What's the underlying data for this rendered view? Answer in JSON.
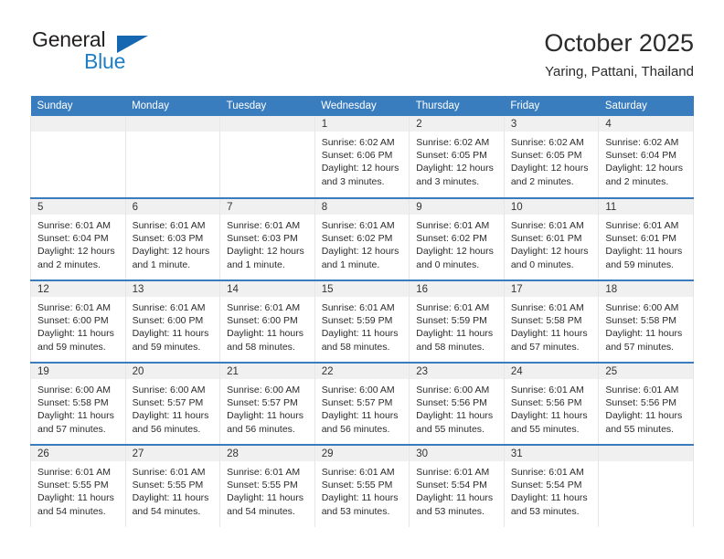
{
  "logo": {
    "primary_text": "General",
    "secondary_text": "Blue",
    "triangle_icon": "triangle-icon",
    "primary_color": "#221f1f",
    "secondary_color": "#1f7ec4",
    "triangle_color": "#1567b2"
  },
  "header": {
    "title": "October 2025",
    "subtitle": "Yaring, Pattani, Thailand"
  },
  "theme": {
    "header_bar_color": "#3a7dbf",
    "daynum_band_color": "#f0f0f0",
    "cell_border_color": "#e6e6e6",
    "text_color": "#2b2b2b"
  },
  "weekday_headers": [
    "Sunday",
    "Monday",
    "Tuesday",
    "Wednesday",
    "Thursday",
    "Friday",
    "Saturday"
  ],
  "weeks": [
    [
      {
        "day": "",
        "empty": true
      },
      {
        "day": "",
        "empty": true
      },
      {
        "day": "",
        "empty": true
      },
      {
        "day": "1",
        "sunrise": "Sunrise: 6:02 AM",
        "sunset": "Sunset: 6:06 PM",
        "daylight": "Daylight: 12 hours and 3 minutes."
      },
      {
        "day": "2",
        "sunrise": "Sunrise: 6:02 AM",
        "sunset": "Sunset: 6:05 PM",
        "daylight": "Daylight: 12 hours and 3 minutes."
      },
      {
        "day": "3",
        "sunrise": "Sunrise: 6:02 AM",
        "sunset": "Sunset: 6:05 PM",
        "daylight": "Daylight: 12 hours and 2 minutes."
      },
      {
        "day": "4",
        "sunrise": "Sunrise: 6:02 AM",
        "sunset": "Sunset: 6:04 PM",
        "daylight": "Daylight: 12 hours and 2 minutes."
      }
    ],
    [
      {
        "day": "5",
        "sunrise": "Sunrise: 6:01 AM",
        "sunset": "Sunset: 6:04 PM",
        "daylight": "Daylight: 12 hours and 2 minutes."
      },
      {
        "day": "6",
        "sunrise": "Sunrise: 6:01 AM",
        "sunset": "Sunset: 6:03 PM",
        "daylight": "Daylight: 12 hours and 1 minute."
      },
      {
        "day": "7",
        "sunrise": "Sunrise: 6:01 AM",
        "sunset": "Sunset: 6:03 PM",
        "daylight": "Daylight: 12 hours and 1 minute."
      },
      {
        "day": "8",
        "sunrise": "Sunrise: 6:01 AM",
        "sunset": "Sunset: 6:02 PM",
        "daylight": "Daylight: 12 hours and 1 minute."
      },
      {
        "day": "9",
        "sunrise": "Sunrise: 6:01 AM",
        "sunset": "Sunset: 6:02 PM",
        "daylight": "Daylight: 12 hours and 0 minutes."
      },
      {
        "day": "10",
        "sunrise": "Sunrise: 6:01 AM",
        "sunset": "Sunset: 6:01 PM",
        "daylight": "Daylight: 12 hours and 0 minutes."
      },
      {
        "day": "11",
        "sunrise": "Sunrise: 6:01 AM",
        "sunset": "Sunset: 6:01 PM",
        "daylight": "Daylight: 11 hours and 59 minutes."
      }
    ],
    [
      {
        "day": "12",
        "sunrise": "Sunrise: 6:01 AM",
        "sunset": "Sunset: 6:00 PM",
        "daylight": "Daylight: 11 hours and 59 minutes."
      },
      {
        "day": "13",
        "sunrise": "Sunrise: 6:01 AM",
        "sunset": "Sunset: 6:00 PM",
        "daylight": "Daylight: 11 hours and 59 minutes."
      },
      {
        "day": "14",
        "sunrise": "Sunrise: 6:01 AM",
        "sunset": "Sunset: 6:00 PM",
        "daylight": "Daylight: 11 hours and 58 minutes."
      },
      {
        "day": "15",
        "sunrise": "Sunrise: 6:01 AM",
        "sunset": "Sunset: 5:59 PM",
        "daylight": "Daylight: 11 hours and 58 minutes."
      },
      {
        "day": "16",
        "sunrise": "Sunrise: 6:01 AM",
        "sunset": "Sunset: 5:59 PM",
        "daylight": "Daylight: 11 hours and 58 minutes."
      },
      {
        "day": "17",
        "sunrise": "Sunrise: 6:01 AM",
        "sunset": "Sunset: 5:58 PM",
        "daylight": "Daylight: 11 hours and 57 minutes."
      },
      {
        "day": "18",
        "sunrise": "Sunrise: 6:00 AM",
        "sunset": "Sunset: 5:58 PM",
        "daylight": "Daylight: 11 hours and 57 minutes."
      }
    ],
    [
      {
        "day": "19",
        "sunrise": "Sunrise: 6:00 AM",
        "sunset": "Sunset: 5:58 PM",
        "daylight": "Daylight: 11 hours and 57 minutes."
      },
      {
        "day": "20",
        "sunrise": "Sunrise: 6:00 AM",
        "sunset": "Sunset: 5:57 PM",
        "daylight": "Daylight: 11 hours and 56 minutes."
      },
      {
        "day": "21",
        "sunrise": "Sunrise: 6:00 AM",
        "sunset": "Sunset: 5:57 PM",
        "daylight": "Daylight: 11 hours and 56 minutes."
      },
      {
        "day": "22",
        "sunrise": "Sunrise: 6:00 AM",
        "sunset": "Sunset: 5:57 PM",
        "daylight": "Daylight: 11 hours and 56 minutes."
      },
      {
        "day": "23",
        "sunrise": "Sunrise: 6:00 AM",
        "sunset": "Sunset: 5:56 PM",
        "daylight": "Daylight: 11 hours and 55 minutes."
      },
      {
        "day": "24",
        "sunrise": "Sunrise: 6:01 AM",
        "sunset": "Sunset: 5:56 PM",
        "daylight": "Daylight: 11 hours and 55 minutes."
      },
      {
        "day": "25",
        "sunrise": "Sunrise: 6:01 AM",
        "sunset": "Sunset: 5:56 PM",
        "daylight": "Daylight: 11 hours and 55 minutes."
      }
    ],
    [
      {
        "day": "26",
        "sunrise": "Sunrise: 6:01 AM",
        "sunset": "Sunset: 5:55 PM",
        "daylight": "Daylight: 11 hours and 54 minutes."
      },
      {
        "day": "27",
        "sunrise": "Sunrise: 6:01 AM",
        "sunset": "Sunset: 5:55 PM",
        "daylight": "Daylight: 11 hours and 54 minutes."
      },
      {
        "day": "28",
        "sunrise": "Sunrise: 6:01 AM",
        "sunset": "Sunset: 5:55 PM",
        "daylight": "Daylight: 11 hours and 54 minutes."
      },
      {
        "day": "29",
        "sunrise": "Sunrise: 6:01 AM",
        "sunset": "Sunset: 5:55 PM",
        "daylight": "Daylight: 11 hours and 53 minutes."
      },
      {
        "day": "30",
        "sunrise": "Sunrise: 6:01 AM",
        "sunset": "Sunset: 5:54 PM",
        "daylight": "Daylight: 11 hours and 53 minutes."
      },
      {
        "day": "31",
        "sunrise": "Sunrise: 6:01 AM",
        "sunset": "Sunset: 5:54 PM",
        "daylight": "Daylight: 11 hours and 53 minutes."
      },
      {
        "day": "",
        "empty": true
      }
    ]
  ]
}
